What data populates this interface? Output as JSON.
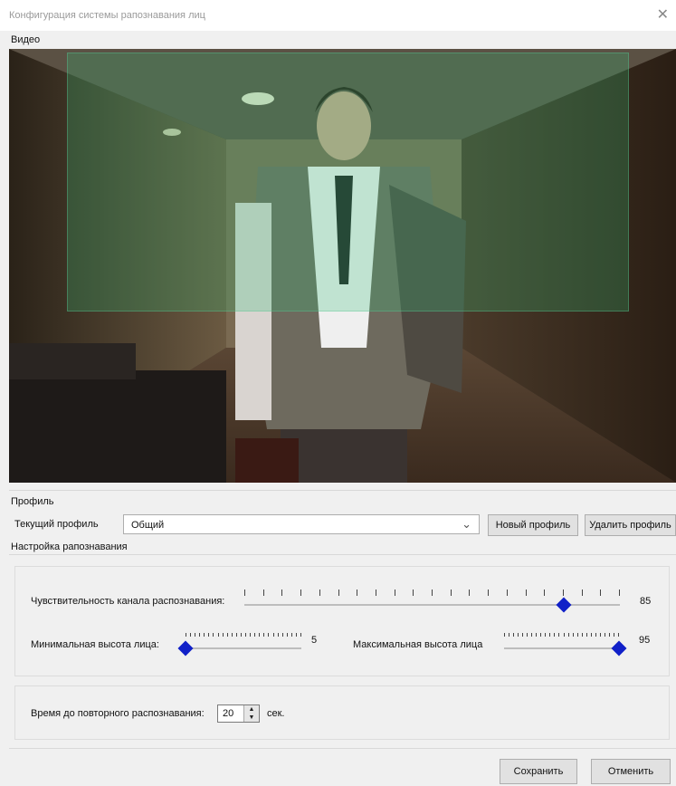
{
  "window": {
    "title": "Конфигурация системы рапознавания лиц",
    "close_glyph": "✕"
  },
  "video": {
    "group_label": "Видео"
  },
  "profile": {
    "group_label": "Профиль",
    "current_label": "Текущий профиль",
    "current_value": "Общий",
    "new_button": "Новый профиль",
    "delete_button": "Удалить профиль"
  },
  "recognition": {
    "group_label": "Настройка рапознавания",
    "sensitivity": {
      "label": "Чувствительность канала распознавания:",
      "value": "85",
      "min": 0,
      "max": 100
    },
    "min_height": {
      "label": "Минимальная высота лица:",
      "value": "5",
      "min": 5,
      "max": 95
    },
    "max_height": {
      "label": "Максимальная высота лица",
      "value": "95",
      "min": 5,
      "max": 95
    },
    "repeat": {
      "label": "Время до повторного распознавания:",
      "value": "20",
      "unit": "сек."
    }
  },
  "footer": {
    "save_button": "Сохранить",
    "cancel_button": "Отменить"
  }
}
